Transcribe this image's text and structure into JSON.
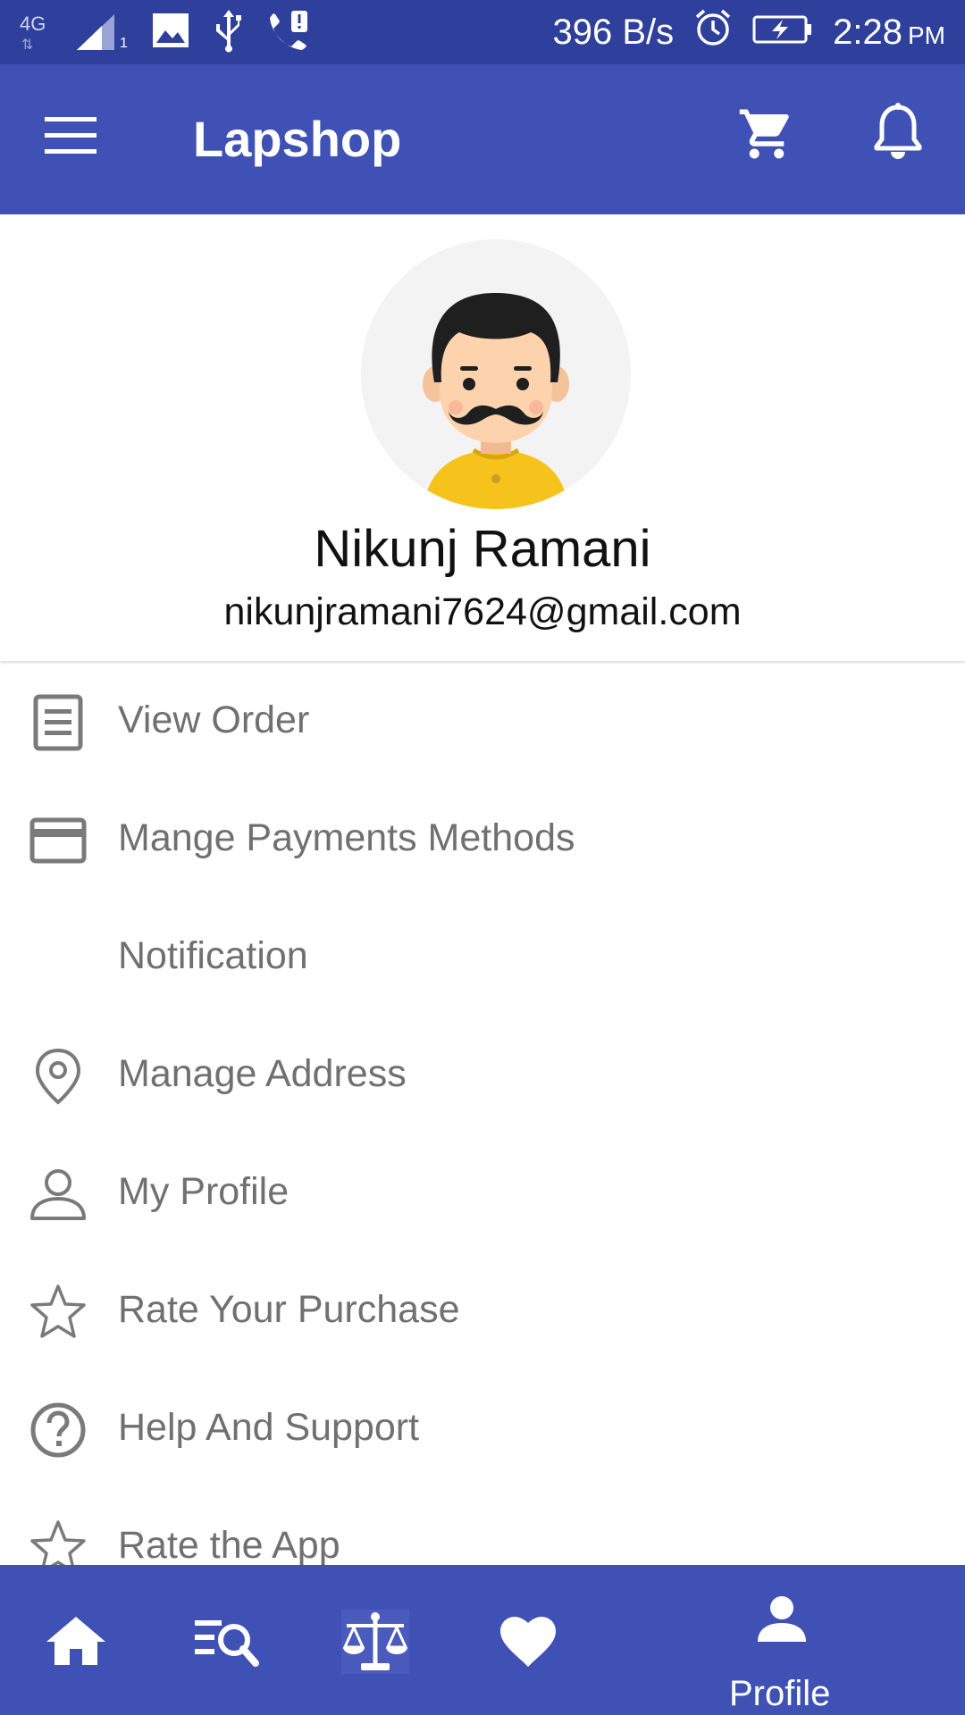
{
  "status_bar": {
    "network": "4G",
    "sim_slot": "1",
    "speed": "396 B/s",
    "time": "2:28",
    "ampm": "PM"
  },
  "app_bar": {
    "title": "Lapshop",
    "icons": [
      "menu-icon",
      "cart-icon",
      "bell-icon"
    ]
  },
  "profile": {
    "name": "Nikunj Ramani",
    "email": "nikunjramani7624@gmail.com"
  },
  "menu": [
    {
      "label": "View Order",
      "icon": "receipt-icon"
    },
    {
      "label": "Mange Payments Methods",
      "icon": "credit-card-icon"
    },
    {
      "label": "Notification",
      "icon": ""
    },
    {
      "label": "Manage Address",
      "icon": "location-pin-icon"
    },
    {
      "label": "My Profile",
      "icon": "person-icon"
    },
    {
      "label": "Rate Your Purchase",
      "icon": "star-icon"
    },
    {
      "label": "Help And Support",
      "icon": "help-icon"
    },
    {
      "label": "Rate the App",
      "icon": "star-icon"
    }
  ],
  "bottom_nav": {
    "items": [
      "home-icon",
      "search-list-icon",
      "compare-scale-icon",
      "heart-icon",
      "profile-icon"
    ],
    "active_label": "Profile"
  },
  "colors": {
    "primary": "#3f51b5",
    "status_bar": "#2f3f9c",
    "menu_text": "#707070"
  }
}
